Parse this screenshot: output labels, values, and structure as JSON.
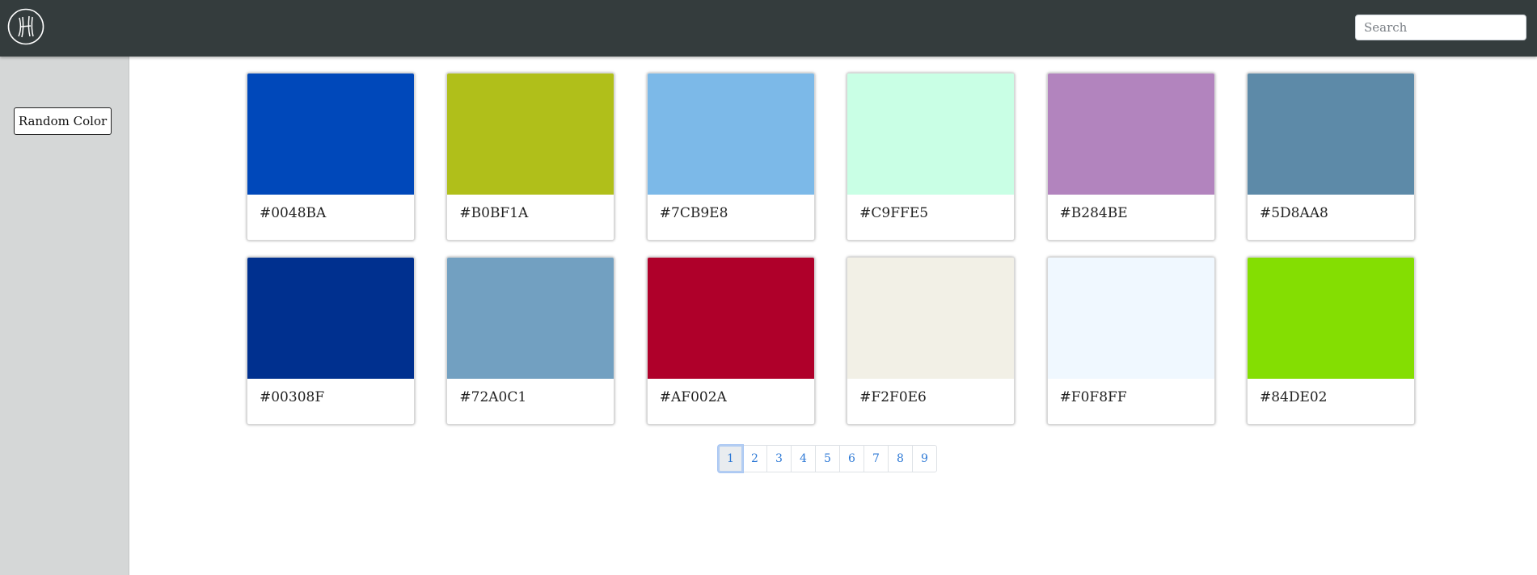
{
  "header": {
    "logo_icon": "h-monogram-logo-icon",
    "search": {
      "placeholder": "Search",
      "value": ""
    }
  },
  "sidebar": {
    "random_button_label": "Random Color"
  },
  "colors": [
    {
      "hex": "#0048BA"
    },
    {
      "hex": "#B0BF1A"
    },
    {
      "hex": "#7CB9E8"
    },
    {
      "hex": "#C9FFE5"
    },
    {
      "hex": "#B284BE"
    },
    {
      "hex": "#5D8AA8"
    },
    {
      "hex": "#00308F"
    },
    {
      "hex": "#72A0C1"
    },
    {
      "hex": "#AF002A"
    },
    {
      "hex": "#F2F0E6"
    },
    {
      "hex": "#F0F8FF"
    },
    {
      "hex": "#84DE02"
    }
  ],
  "pagination": {
    "pages": [
      "1",
      "2",
      "3",
      "4",
      "5",
      "6",
      "7",
      "8",
      "9"
    ],
    "active": "1"
  },
  "theme": {
    "topbar": "#343c3d",
    "sidebar": "#d5d7d7",
    "link": "#2f7ad6"
  }
}
